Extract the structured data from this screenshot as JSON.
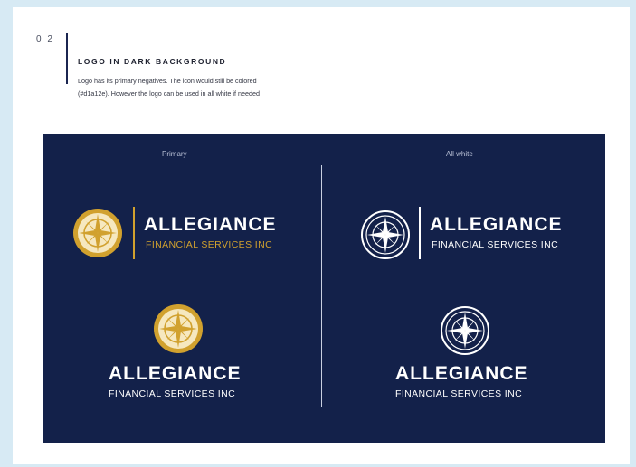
{
  "page_number": "0 2",
  "section_title": "LOGO IN DARK BACKGROUND",
  "description_line1": "Logo has its primary negatives. The icon would still be colored",
  "description_line2": "(#d1a12e). However the logo can be used in all white if needed",
  "panel": {
    "primary_label": "Primary",
    "white_label": "All white"
  },
  "logo": {
    "brand": "ALLEGIANCE",
    "subtitle": "FINANCIAL SERVICES INC"
  },
  "colors": {
    "background": "#13214a",
    "icon_gold": "#d1a12e",
    "icon_cream": "#f6e8bf",
    "white": "#ffffff"
  },
  "icons": [
    "compass-icon"
  ]
}
